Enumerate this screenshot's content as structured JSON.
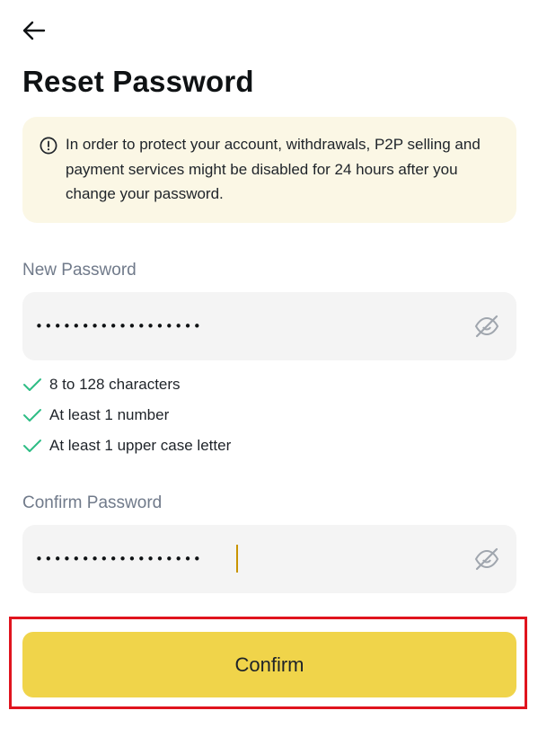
{
  "header": {
    "back_icon": "arrow-left-icon",
    "title": "Reset Password"
  },
  "notice": {
    "icon": "info-circle-icon",
    "text": "In order to protect your account, withdrawals, P2P selling and payment services might be disabled for 24 hours after you change your password.",
    "background": "#fbf7e5"
  },
  "new_password": {
    "label": "New Password",
    "value": "••••••••••••••••••",
    "visibility_icon": "eye-slash-icon"
  },
  "requirements": [
    {
      "label": "8 to 128 characters",
      "met": true
    },
    {
      "label": "At least 1 number",
      "met": true
    },
    {
      "label": "At least 1 upper case letter",
      "met": true
    }
  ],
  "confirm_password": {
    "label": "Confirm Password",
    "value": "••••••••••••••••••",
    "visibility_icon": "eye-slash-icon"
  },
  "confirm_button": {
    "label": "Confirm",
    "color": "#f0d44a",
    "highlight_color": "#e0141e"
  },
  "colors": {
    "check": "#2ebd85",
    "caret": "#c99400"
  }
}
